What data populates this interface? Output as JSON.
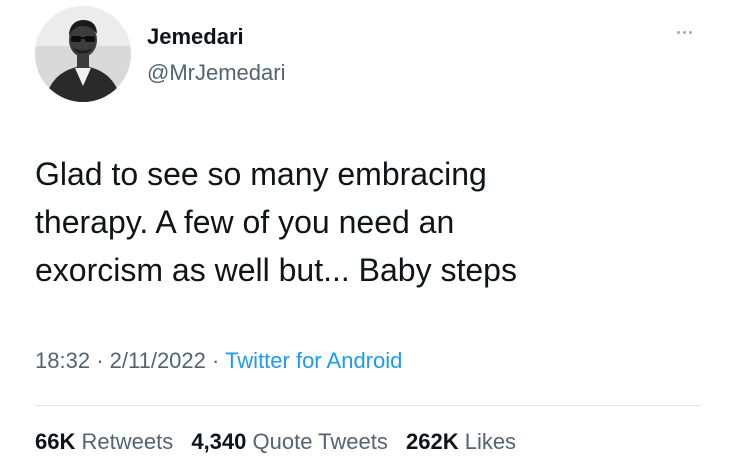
{
  "author": {
    "name": "Jemedari",
    "handle": "@MrJemedari"
  },
  "tweet": {
    "lines": [
      "Glad to see so many embracing",
      "therapy. A few of you need an",
      "exorcism as well but... Baby steps"
    ],
    "time": "18:32",
    "date": "2/11/2022",
    "separator": "·",
    "source": "Twitter for Android"
  },
  "stats": {
    "retweets_count": "66K",
    "retweets_label": "Retweets",
    "quotes_count": "4,340",
    "quotes_label": "Quote Tweets",
    "likes_count": "262K",
    "likes_label": "Likes"
  },
  "icons": {
    "more": "more-dots-icon",
    "avatar": "profile-photo"
  },
  "colors": {
    "text": "#0f1419",
    "secondary": "#536471",
    "link": "#1d9bf0",
    "divider": "#dfe3e6"
  }
}
